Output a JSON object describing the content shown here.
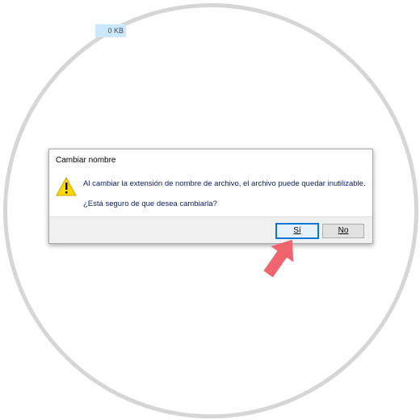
{
  "background": {
    "file_size_text": "0 KB"
  },
  "dialog": {
    "title": "Cambiar nombre",
    "icon": "warning-icon",
    "message": "Al cambiar la extensión de nombre de archivo, el archivo puede quedar inutilizable.",
    "question": "¿Está seguro de que desea cambiarla?",
    "buttons": {
      "yes_label": "Sí",
      "no_label": "No"
    }
  },
  "colors": {
    "accent": "#0078d7",
    "arrow": "#f0646e",
    "warning_fill": "#ffd700"
  }
}
